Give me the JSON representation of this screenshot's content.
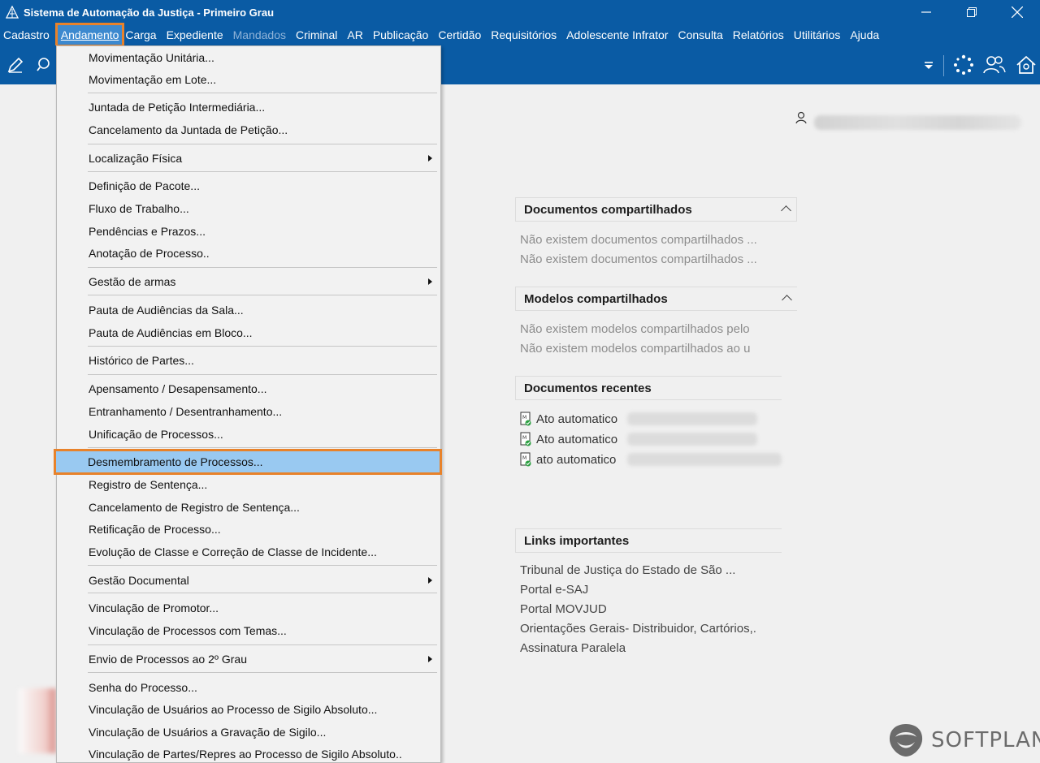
{
  "window": {
    "title": "Sistema de Automação da Justiça - Primeiro Grau"
  },
  "menubar": {
    "items": [
      {
        "label": "Cadastro",
        "state": "normal"
      },
      {
        "label": "Andamento",
        "state": "active"
      },
      {
        "label": "Carga",
        "state": "normal"
      },
      {
        "label": "Expediente",
        "state": "normal"
      },
      {
        "label": "Mandados",
        "state": "disabled"
      },
      {
        "label": "Criminal",
        "state": "normal"
      },
      {
        "label": "AR",
        "state": "normal"
      },
      {
        "label": "Publicação",
        "state": "normal"
      },
      {
        "label": "Certidão",
        "state": "normal"
      },
      {
        "label": "Requisitórios",
        "state": "normal"
      },
      {
        "label": "Adolescente Infrator",
        "state": "normal"
      },
      {
        "label": "Consulta",
        "state": "normal"
      },
      {
        "label": "Relatórios",
        "state": "normal"
      },
      {
        "label": "Utilitários",
        "state": "normal"
      },
      {
        "label": "Ajuda",
        "state": "normal"
      }
    ]
  },
  "toolbar": {
    "icons": [
      "edit-icon",
      "search-icon",
      "dropdown-arrow-icon",
      "loading-icon",
      "users-icon",
      "home-icon"
    ]
  },
  "andamento_menu": {
    "items": [
      {
        "label": "Movimentação Unitária...",
        "submenu": false
      },
      {
        "label": "Movimentação em Lote...",
        "submenu": false
      },
      {
        "label": "Juntada de Petição Intermediária...",
        "submenu": false
      },
      {
        "label": "Cancelamento da Juntada de Petição...",
        "submenu": false
      },
      {
        "label": "Localização Física",
        "submenu": true
      },
      {
        "label": "Definição de Pacote...",
        "submenu": false
      },
      {
        "label": "Fluxo de Trabalho...",
        "submenu": false
      },
      {
        "label": "Pendências e Prazos...",
        "submenu": false
      },
      {
        "label": "Anotação de Processo..",
        "submenu": false
      },
      {
        "label": "Gestão de armas",
        "submenu": true
      },
      {
        "label": "Pauta de Audiências da Sala...",
        "submenu": false
      },
      {
        "label": "Pauta de Audiências em Bloco...",
        "submenu": false
      },
      {
        "label": "Histórico de Partes...",
        "submenu": false
      },
      {
        "label": "Apensamento / Desapensamento...",
        "submenu": false
      },
      {
        "label": "Entranhamento / Desentranhamento...",
        "submenu": false
      },
      {
        "label": "Unificação de Processos...",
        "submenu": false
      },
      {
        "label": "Desmembramento de Processos...",
        "submenu": false,
        "highlighted": true
      },
      {
        "label": "Registro de Sentença...",
        "submenu": false
      },
      {
        "label": "Cancelamento de Registro de Sentença...",
        "submenu": false
      },
      {
        "label": "Retificação de Processo...",
        "submenu": false
      },
      {
        "label": "Evolução de Classe e Correção de Classe de Incidente...",
        "submenu": false
      },
      {
        "label": "Gestão Documental",
        "submenu": true
      },
      {
        "label": "Vinculação de Promotor...",
        "submenu": false
      },
      {
        "label": "Vinculação de Processos com Temas...",
        "submenu": false
      },
      {
        "label": "Envio de Processos ao 2º Grau",
        "submenu": true
      },
      {
        "label": "Senha do Processo...",
        "submenu": false
      },
      {
        "label": "Vinculação de Usuários ao Processo de Sigilo Absoluto...",
        "submenu": false
      },
      {
        "label": "Vinculação de Usuários a Gravação de Sigilo...",
        "submenu": false
      },
      {
        "label": "Vinculação de Partes/Repres ao Processo de Sigilo Absoluto..",
        "submenu": false
      }
    ]
  },
  "panels": {
    "shared_docs": {
      "title": "Documentos compartilhados",
      "lines": [
        "Não existem documentos compartilhados ...",
        "Não existem documentos compartilhados ..."
      ]
    },
    "shared_models": {
      "title": "Modelos compartilhados",
      "lines": [
        "Não existem modelos compartilhados pelo",
        "Não existem modelos compartilhados ao u"
      ]
    },
    "recent_docs": {
      "title": "Documentos recentes",
      "items": [
        "Ato automatico",
        "Ato automatico",
        "ato automatico"
      ]
    },
    "links": {
      "title": "Links importantes",
      "items": [
        "Tribunal de Justiça do Estado de São ...",
        "Portal e-SAJ",
        "Portal MOVJUD",
        "Orientações Gerais- Distribuidor, Cartórios,.",
        "Assinatura Paralela"
      ]
    }
  },
  "branding": {
    "logo_text": "SOFTPLAN"
  },
  "colors": {
    "titlebar": "#0a5ba4",
    "highlight": "#99c9f1",
    "callout": "#e8822a"
  }
}
